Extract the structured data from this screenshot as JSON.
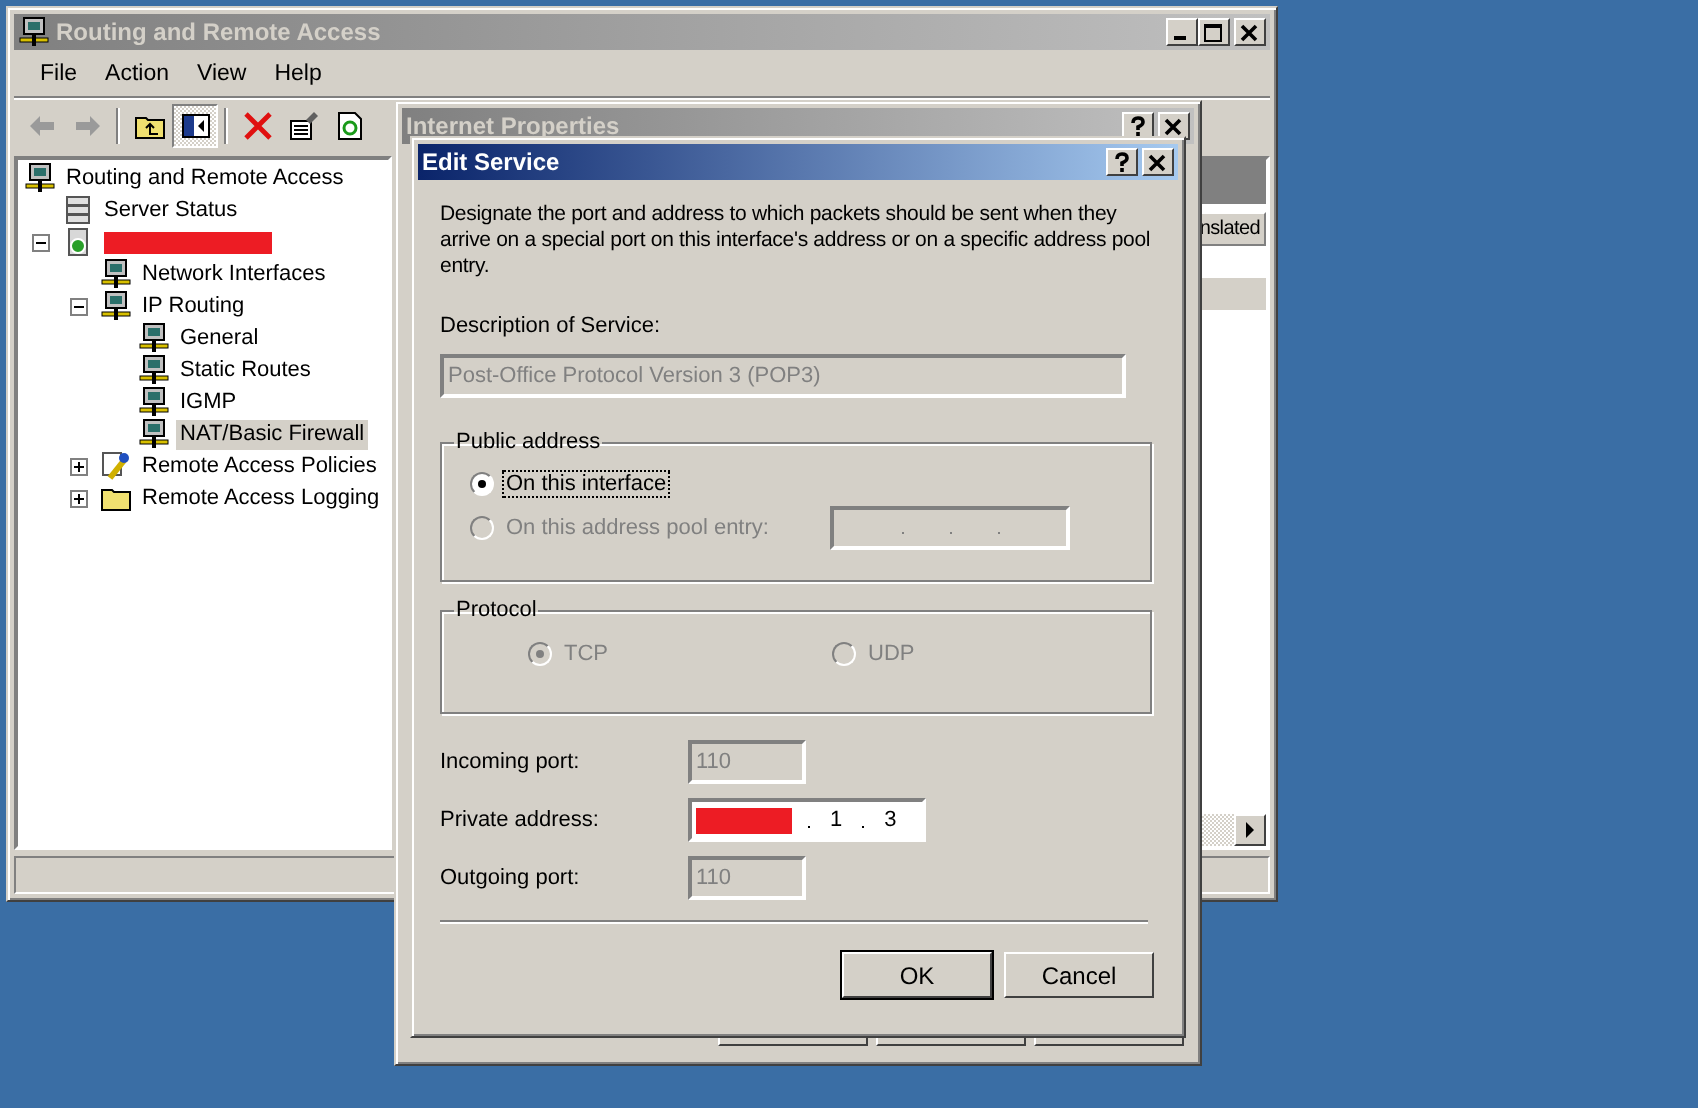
{
  "main_window": {
    "title": "Routing and Remote Access",
    "active": false
  },
  "menu": [
    "File",
    "Action",
    "View",
    "Help"
  ],
  "toolbar": [
    {
      "kind": "back",
      "pressed": false
    },
    {
      "kind": "forward",
      "pressed": false
    },
    {
      "kind": "separator"
    },
    {
      "kind": "up",
      "pressed": false
    },
    {
      "kind": "tree",
      "pressed": true
    },
    {
      "kind": "separator"
    },
    {
      "kind": "delete",
      "pressed": false
    },
    {
      "kind": "properties",
      "pressed": false
    },
    {
      "kind": "refresh",
      "pressed": false
    }
  ],
  "tree": {
    "items": [
      {
        "label": "Routing and Remote Access",
        "kind": "computer",
        "selected": false,
        "children": [
          {
            "label": "Server Status",
            "kind": "status",
            "selected": false
          },
          {
            "redacted": true,
            "kind": "server",
            "selected": false,
            "expanded": true,
            "children": [
              {
                "label": "Network Interfaces",
                "kind": "computer",
                "selected": false
              },
              {
                "label": "IP Routing",
                "kind": "computer",
                "selected": false,
                "expanded": true,
                "children": [
                  {
                    "label": "General",
                    "kind": "computer",
                    "selected": false
                  },
                  {
                    "label": "Static Routes",
                    "kind": "computer",
                    "selected": false
                  },
                  {
                    "label": "IGMP",
                    "kind": "computer",
                    "selected": false
                  },
                  {
                    "label": "NAT/Basic Firewall",
                    "kind": "computer",
                    "selected": true
                  }
                ]
              },
              {
                "label": "Remote Access Policies",
                "kind": "policy",
                "selected": false,
                "expanded": false
              },
              {
                "label": "Remote Access Logging",
                "kind": "folder",
                "selected": false,
                "expanded": false
              }
            ]
          }
        ]
      }
    ]
  },
  "right_pane": {
    "column_header": "nslated",
    "rows": [
      {
        "selected": false
      },
      {
        "selected": true
      }
    ]
  },
  "properties_dialog": {
    "title": "Internet Properties",
    "active": false
  },
  "edit_service": {
    "title": "Edit Service",
    "active": true,
    "intro": "Designate the port and address to which packets should be sent when they arrive on a special port on this interface's address or on a specific address pool entry.",
    "description_label": "Description of Service:",
    "description": {
      "value": "Post-Office Protocol Version 3 (POP3)",
      "disabled": true
    },
    "public_address": {
      "title": "Public address",
      "options": [
        {
          "label": "On this interface",
          "selected": true,
          "disabled": false,
          "focused": true
        },
        {
          "label": "On this address pool entry:",
          "selected": false,
          "disabled": true,
          "focused": false
        }
      ]
    },
    "protocol": {
      "title": "Protocol",
      "options": [
        {
          "label": "TCP",
          "selected": true,
          "disabled": true
        },
        {
          "label": "UDP",
          "selected": false,
          "disabled": true
        }
      ]
    },
    "incoming_port": {
      "label": "Incoming port:",
      "value": "110",
      "disabled": true
    },
    "private_address": {
      "label": "Private address:",
      "disabled": false,
      "octets": [
        {
          "redacted": true
        },
        {
          "redacted": false,
          "text": "1"
        },
        {
          "redacted": false,
          "text": "3"
        }
      ]
    },
    "outgoing_port": {
      "label": "Outgoing port:",
      "value": "110",
      "disabled": true
    },
    "buttons": [
      {
        "label": "OK",
        "default": true
      },
      {
        "label": "Cancel",
        "default": false
      }
    ]
  }
}
